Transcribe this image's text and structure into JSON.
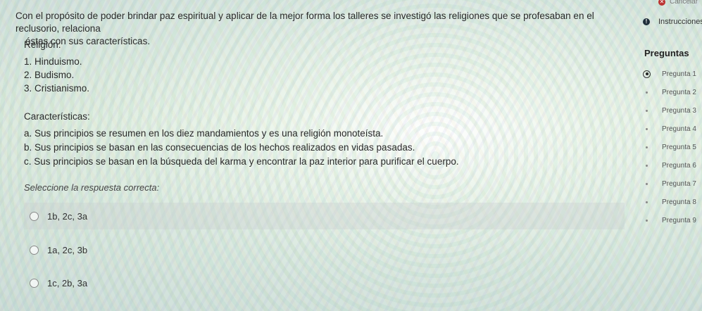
{
  "question": {
    "intro_line1": "Con el propósito de poder brindar paz espiritual y aplicar de la mejor forma los talleres se investigó las religiones que se profesaban en el reclusorio, relaciona",
    "intro_line2": "éstas con sus características.",
    "religion_label": "Religión:",
    "religions": [
      "1. Hinduismo.",
      "2. Budismo.",
      "3. Cristianismo."
    ],
    "characteristics_label": "Características:",
    "characteristics": [
      "a. Sus principios se resumen en los diez mandamientos y es una religión monoteísta.",
      "b. Sus principios se basan en las consecuencias de los hechos realizados en vidas pasadas.",
      "c. Sus principios se basan en la búsqueda del karma y encontrar la paz interior para purificar el cuerpo."
    ],
    "instruction": "Seleccione la respuesta correcta:",
    "options": [
      "1b, 2c, 3a",
      "1a, 2c, 3b",
      "1c, 2b, 3a"
    ]
  },
  "sidebar": {
    "cancel_label": "Cancelar",
    "instructions_label": "Instrucciones",
    "title": "Preguntas",
    "questions": [
      "Pregunta 1",
      "Pregunta 2",
      "Pregunta 3",
      "Pregunta 4",
      "Pregunta 5",
      "Pregunta 6",
      "Pregunta 7",
      "Pregunta 8",
      "Pregunta 9"
    ],
    "active_index": 0
  },
  "icons": {
    "cancel": "close-icon",
    "instructions": "info-icon"
  }
}
